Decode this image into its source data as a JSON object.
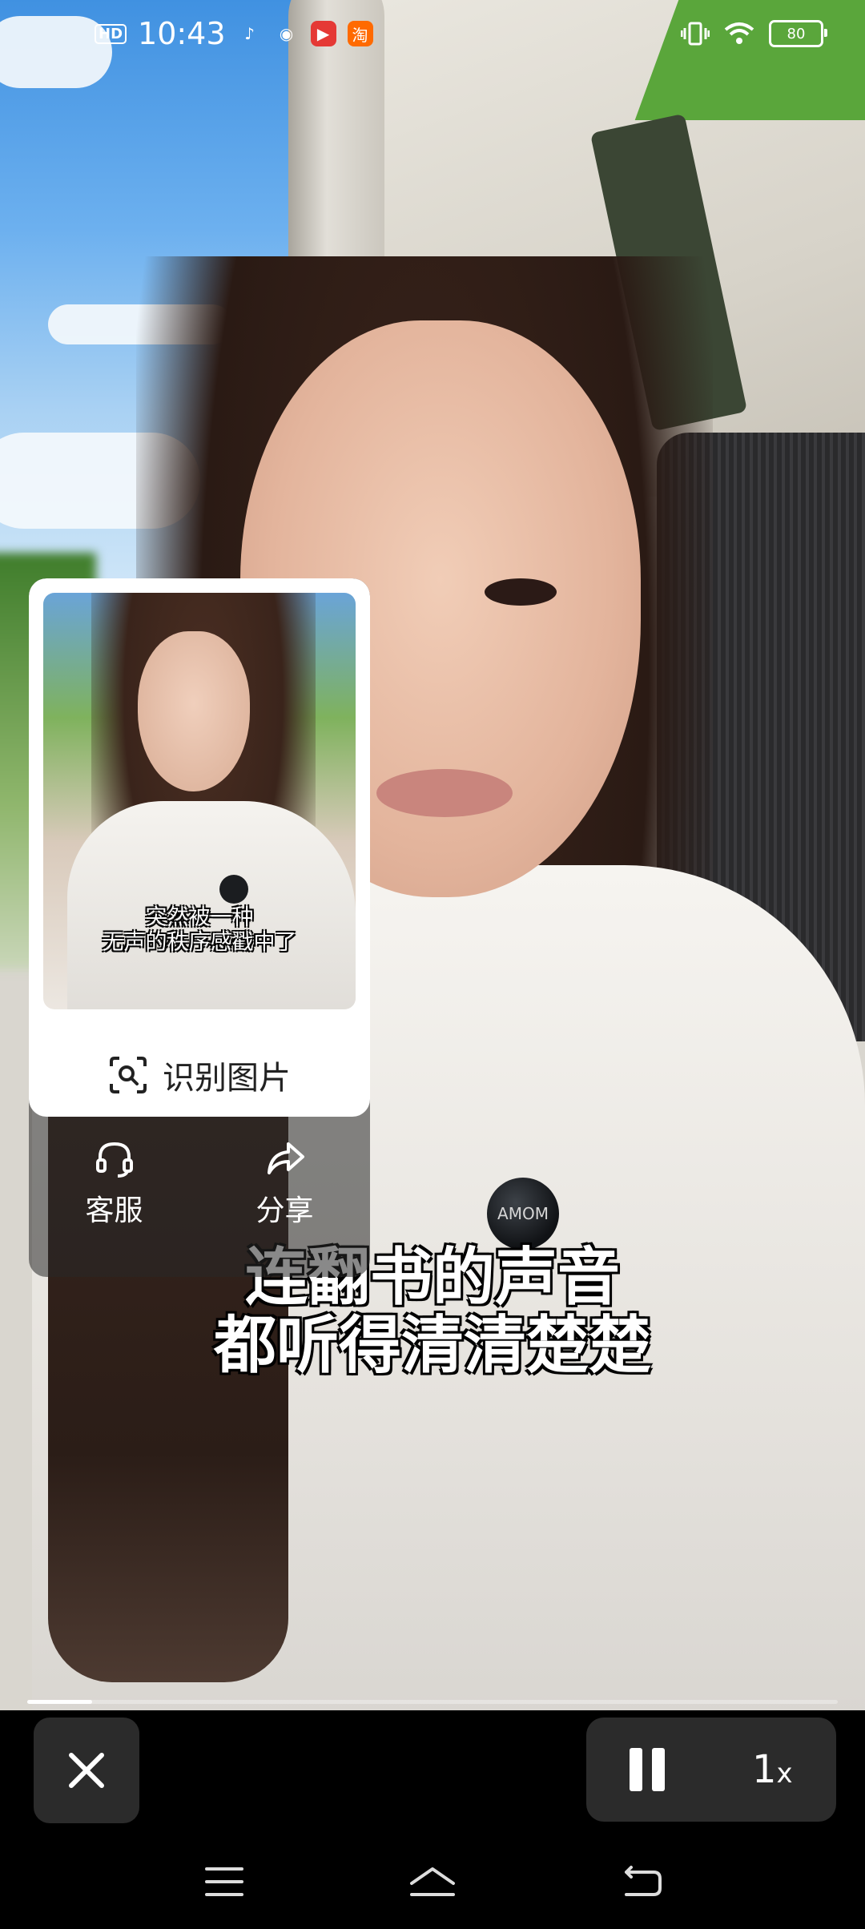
{
  "status_bar": {
    "hd_badge": "HD",
    "time": "10:43",
    "app_icons": [
      "tiktok-icon",
      "weibo-icon",
      "video-app-icon",
      "taobao-icon"
    ],
    "battery": "80"
  },
  "video": {
    "subtitle_line1": "连翻书的声音",
    "subtitle_line2": "都听得清清楚楚",
    "pin_text": "AMOM",
    "progress": 0.08
  },
  "floating_card": {
    "caption_line1": "突然被一种",
    "caption_line2": "无声的秩序感戳中了",
    "recognize_label": "识别图片",
    "actions": [
      {
        "label": "客服",
        "icon": "headset-icon"
      },
      {
        "label": "分享",
        "icon": "share-icon"
      }
    ]
  },
  "controls": {
    "speed_value": "1",
    "speed_unit": "x"
  },
  "colors": {
    "panel_bg": "#2b2b2b",
    "card_bg": "#ffffff"
  }
}
